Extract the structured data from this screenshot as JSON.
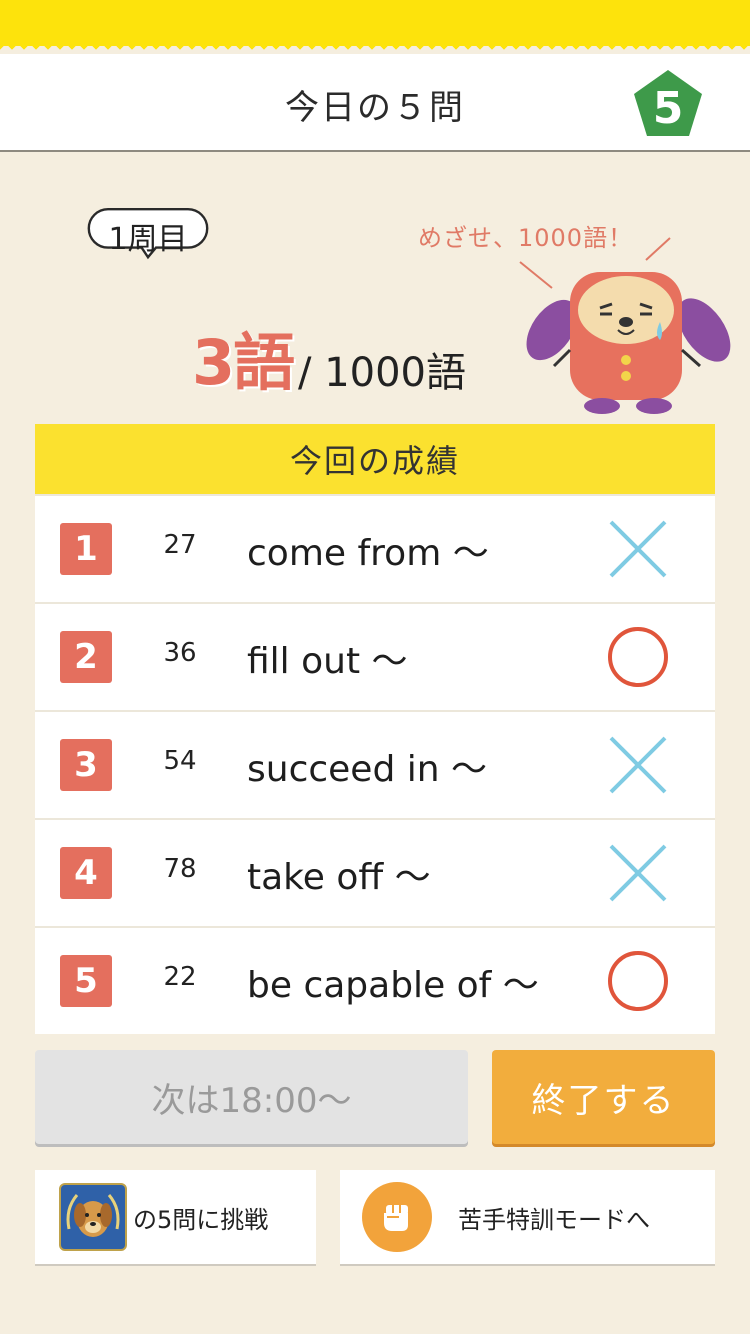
{
  "header": {
    "title": "今日の５問",
    "badge_number": "5",
    "badge_color": "#3e9a4a"
  },
  "progress": {
    "lap_label": "1周目",
    "goal_text": "めざせ、1000語！",
    "learned_count": "3語",
    "total_text": "/ 1000語"
  },
  "results": {
    "heading": "今回の成績",
    "rows": [
      {
        "index": "1",
        "word_no": "27",
        "phrase": "come from 〜",
        "result": "incorrect"
      },
      {
        "index": "2",
        "word_no": "36",
        "phrase": "fill out 〜",
        "result": "correct"
      },
      {
        "index": "3",
        "word_no": "54",
        "phrase": "succeed in 〜",
        "result": "incorrect"
      },
      {
        "index": "4",
        "word_no": "78",
        "phrase": "take off 〜",
        "result": "incorrect"
      },
      {
        "index": "5",
        "word_no": "22",
        "phrase": "be capable of 〜",
        "result": "correct"
      }
    ],
    "correct_color": "#e0553b",
    "incorrect_color": "#7fcbe3"
  },
  "actions": {
    "next_label": "次は18:00〜",
    "end_label": "終了する"
  },
  "links": {
    "challenge_label": "の5問に挑戦",
    "training_label": "苦手特訓モードへ"
  },
  "colors": {
    "accent_yellow": "#fde30c",
    "accent_red": "#e46f5e",
    "accent_orange": "#f2ad3d",
    "background": "#f5eedf"
  }
}
